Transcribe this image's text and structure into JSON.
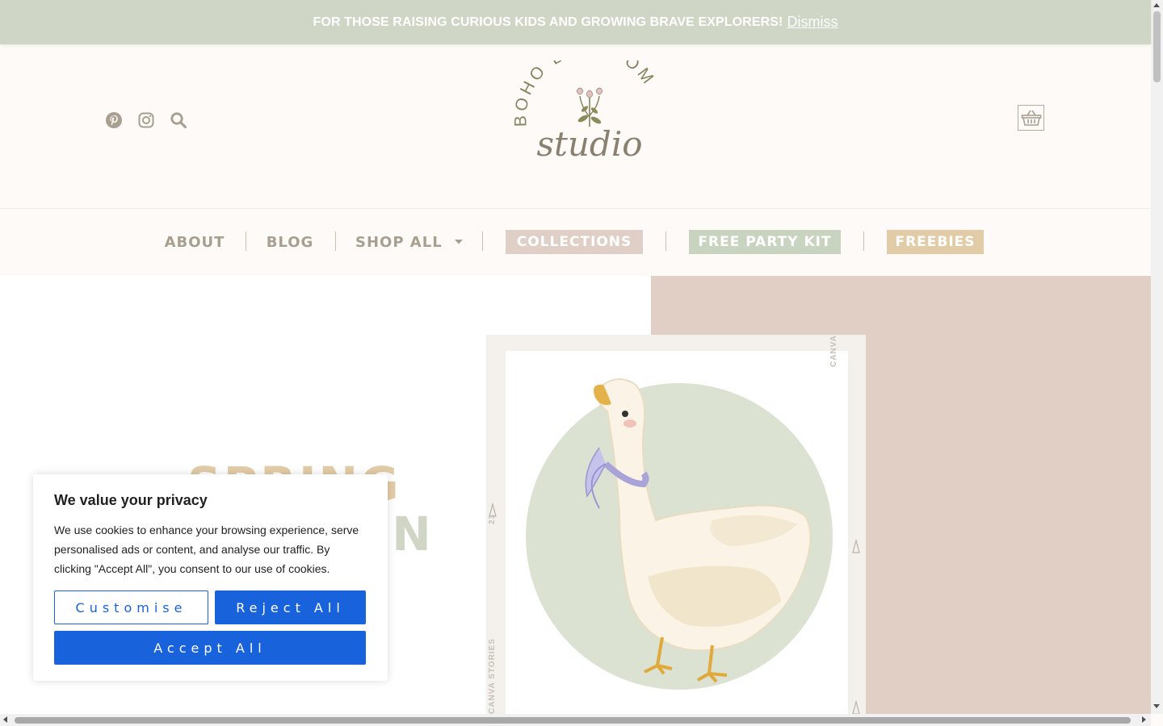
{
  "announcement": {
    "text": "FOR THOSE RAISING CURIOUS KIDS AND GROWING BRAVE EXPLORERS!",
    "dismiss_label": "Dismiss"
  },
  "header": {
    "social_icons": [
      "pinterest-icon",
      "instagram-icon",
      "search-icon"
    ],
    "logo": {
      "arc_text": "BOHO BLOSSOM",
      "script_text": "studio"
    },
    "cart_icon": "basket-icon"
  },
  "nav": {
    "items": [
      {
        "label": "ABOUT"
      },
      {
        "label": "BLOG"
      },
      {
        "label": "SHOP ALL",
        "has_dropdown": true
      },
      {
        "label": "COLLECTIONS",
        "background": "#e0cfc6"
      },
      {
        "label": "FREE PARTY KIT",
        "background": "#c9d4c0"
      },
      {
        "label": "FREEBIES",
        "background": "#e2cca8"
      }
    ]
  },
  "hero": {
    "heading_line1": "SPRING",
    "heading_line2": "ON",
    "frame_side_texts": [
      "CANVA STORIES",
      "23",
      "CANVA STORIES"
    ]
  },
  "cookie_banner": {
    "title": "We value your privacy",
    "body": "We use cookies to enhance your browsing experience, serve personalised ads or content, and analyse our traffic. By clicking \"Accept All\", you consent to our use of cookies.",
    "customise_label": "Customise",
    "reject_label": "Reject All",
    "accept_label": "Accept All"
  },
  "colors": {
    "announcement_bg": "#cfd6c5",
    "header_bg": "#fdfaf7",
    "nav_text": "#a89f90",
    "hero_right_bg": "#e1cfc6",
    "cookie_accent": "#1863dc"
  }
}
